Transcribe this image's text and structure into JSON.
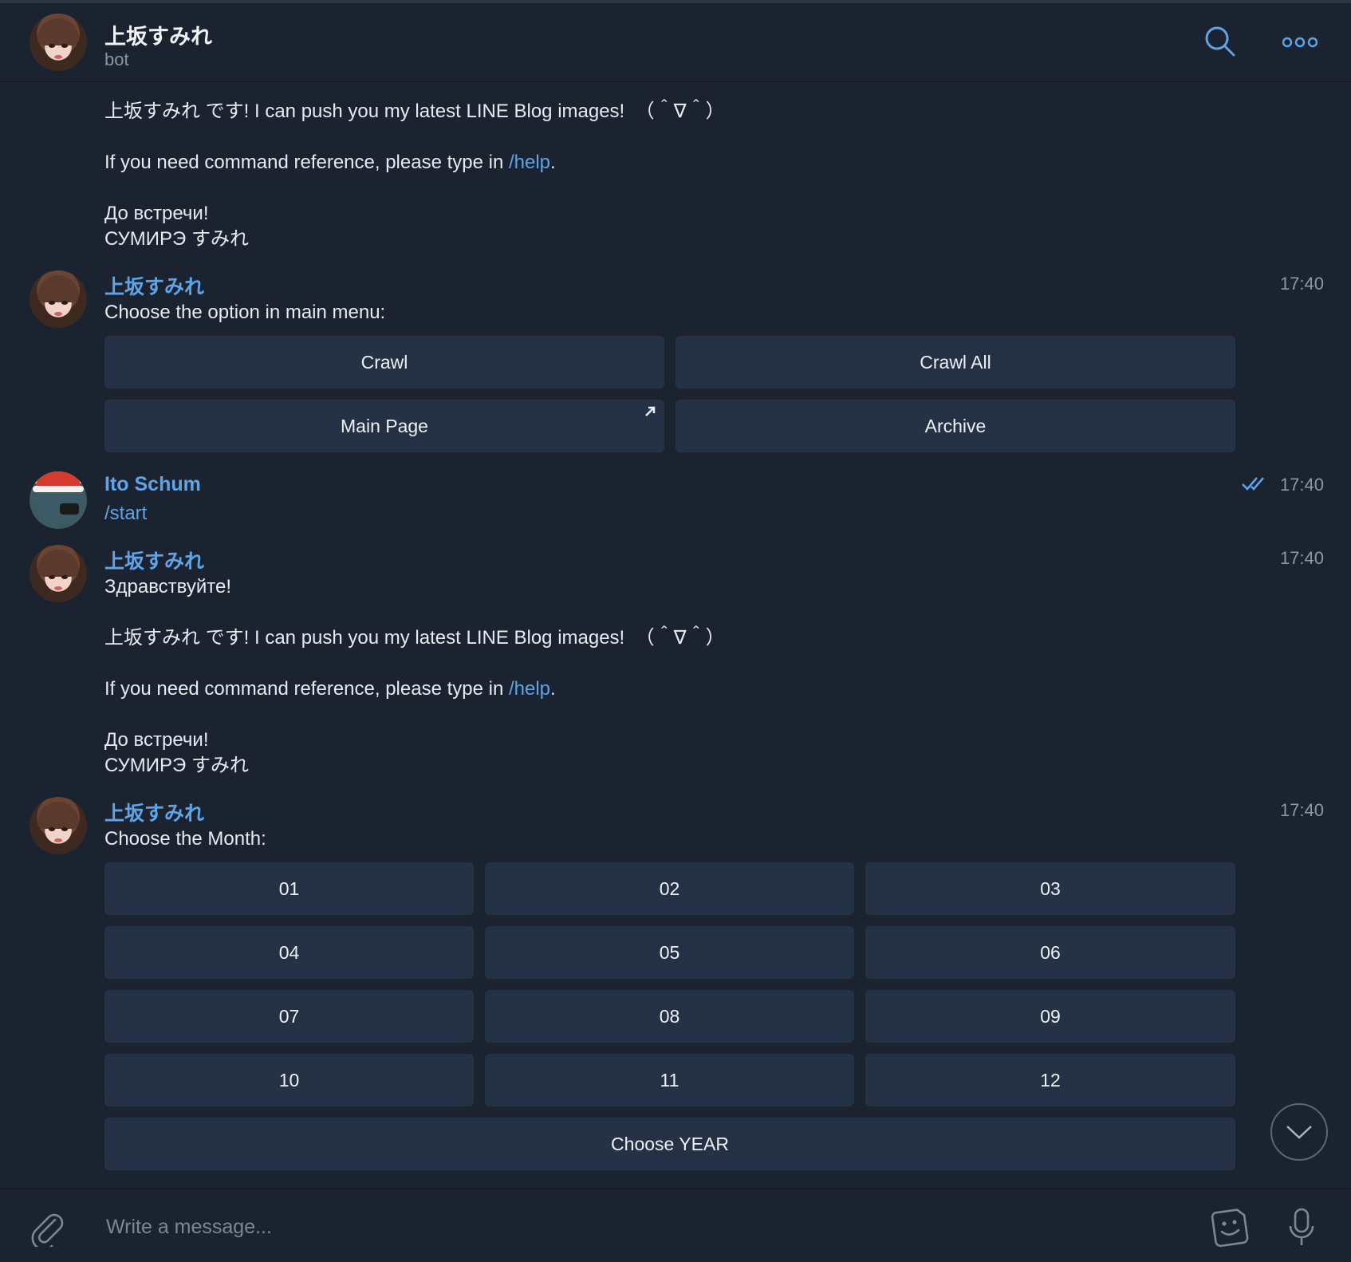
{
  "header": {
    "title": "上坂すみれ",
    "subtitle": "bot",
    "search_icon": "search-icon",
    "more_icon": "more-icon"
  },
  "messages": {
    "first_partial": {
      "line1": "上坂すみれ です! I can push you my latest LINE Blog images!  （＾∇＾）",
      "line2_pre": "If you need command reference, please type in ",
      "line2_link": "/help",
      "line2_post": ".",
      "line3": "До встречи!",
      "line4": "СУМИРЭ すみれ"
    },
    "menu": {
      "sender": "上坂すみれ",
      "time": "17:40",
      "text": "Choose the option in main menu:",
      "buttons": [
        "Crawl",
        "Crawl All",
        "Main Page",
        "Archive"
      ]
    },
    "user": {
      "sender": "Ito Schum",
      "time": "17:40",
      "text": "/start"
    },
    "greeting": {
      "sender": "上坂すみれ",
      "time": "17:40",
      "line0": "Здравствуйте!",
      "line1": "上坂すみれ です! I can push you my latest LINE Blog images!  （＾∇＾）",
      "line2_pre": "If you need command reference, please type in ",
      "line2_link": "/help",
      "line2_post": ".",
      "line3": "До встречи!",
      "line4": "СУМИРЭ すみれ"
    },
    "month": {
      "sender": "上坂すみれ",
      "time": "17:40",
      "text": "Choose the Month:",
      "months": [
        "01",
        "02",
        "03",
        "04",
        "05",
        "06",
        "07",
        "08",
        "09",
        "10",
        "11",
        "12"
      ],
      "year_button": "Choose YEAR"
    }
  },
  "input": {
    "placeholder": "Write a message..."
  },
  "colors": {
    "background": "#1c2330",
    "accent": "#5ea4e6",
    "button_bg": "#253245"
  }
}
